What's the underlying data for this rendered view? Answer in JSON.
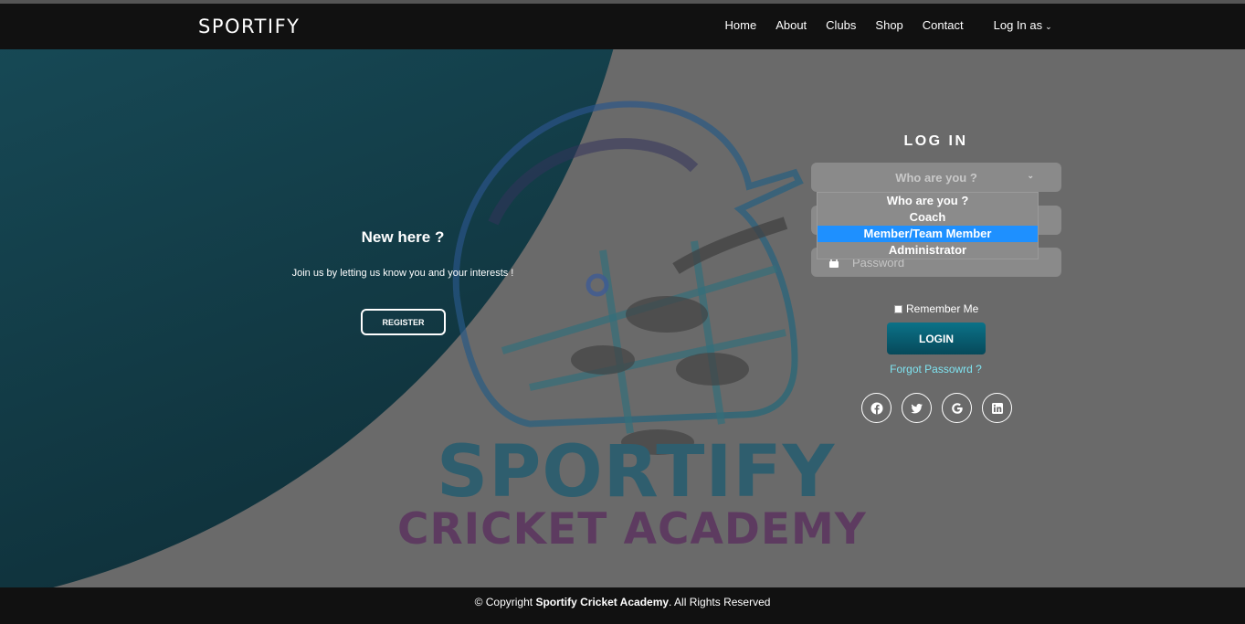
{
  "navbar": {
    "brand": "SPORTIFY",
    "links": [
      "Home",
      "About",
      "Clubs",
      "Shop",
      "Contact"
    ],
    "login_as": "Log In as"
  },
  "logo": {
    "title": "SPORTIFY",
    "subtitle": "CRICKET ACADEMY"
  },
  "left_panel": {
    "heading": "New here ?",
    "text": "Join us by letting us know you and your interests !",
    "register_label": "REGISTER"
  },
  "login": {
    "title": "LOG IN",
    "role_select_value": "Who are you ?",
    "role_options": [
      "Who are you ?",
      "Coach",
      "Member/Team Member",
      "Administrator"
    ],
    "highlighted_option": "Member/Team Member",
    "password_placeholder": "Password",
    "remember_label": "Remember Me",
    "login_label": "LOGIN",
    "forgot_label": "Forgot Passowrd ?",
    "socials": [
      "facebook-icon",
      "twitter-icon",
      "google-icon",
      "linkedin-icon"
    ]
  },
  "footer": {
    "prefix": "© Copyright ",
    "brand": "Sportify Cricket Academy",
    "suffix": ". All Rights Reserved"
  },
  "colors": {
    "accent": "#0b7288",
    "link": "#7fe3f0",
    "dropdown_highlight": "#1e90ff",
    "navbar": "#111111"
  }
}
